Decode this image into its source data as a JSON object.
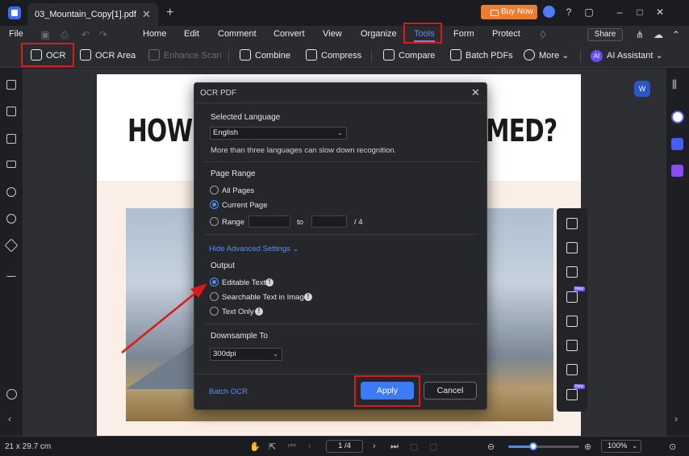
{
  "window": {
    "tab_title": "03_Mountain_Copy[1].pdf",
    "buy_now": "Buy Now"
  },
  "menu": {
    "file": "File",
    "items": [
      "Home",
      "Edit",
      "Comment",
      "Convert",
      "View",
      "Organize",
      "Tools",
      "Form",
      "Protect"
    ],
    "active": "Tools",
    "share": "Share"
  },
  "toolbar": {
    "ocr": "OCR",
    "ocr_area": "OCR Area",
    "enhance_scan": "Enhance Scan",
    "combine": "Combine",
    "compress": "Compress",
    "compare": "Compare",
    "batch_pdfs": "Batch PDFs",
    "more": "More",
    "ai_badge": "AI",
    "ai_assistant": "AI Assistant"
  },
  "document": {
    "headline_left": "HOW",
    "headline_right": "MED?"
  },
  "dialog": {
    "title": "OCR PDF",
    "selected_language_label": "Selected Language",
    "language_value": "English",
    "language_note": "More than three languages can slow down recognition.",
    "page_range_label": "Page Range",
    "all_pages": "All Pages",
    "current_page": "Current Page",
    "range": "Range",
    "range_to": "to",
    "range_total": "/ 4",
    "advanced_toggle": "Hide Advanced Settings",
    "output_label": "Output",
    "editable_text": "Editable Text",
    "searchable_text": "Searchable Text in Image",
    "text_only": "Text Only",
    "downsample_label": "Downsample To",
    "downsample_value": "300dpi",
    "batch_ocr": "Batch OCR",
    "apply": "Apply",
    "cancel": "Cancel"
  },
  "floating_tools": {
    "new_tag": "New"
  },
  "doc_badge": "W",
  "status": {
    "page_size": "21 x 29.7 cm",
    "page_indicator": "1 /4",
    "zoom": "100%",
    "zoom_fraction": 0.35
  },
  "colors": {
    "accent": "#4f8df8",
    "highlight": "#e01717",
    "buy_now": "#f07b2d"
  }
}
